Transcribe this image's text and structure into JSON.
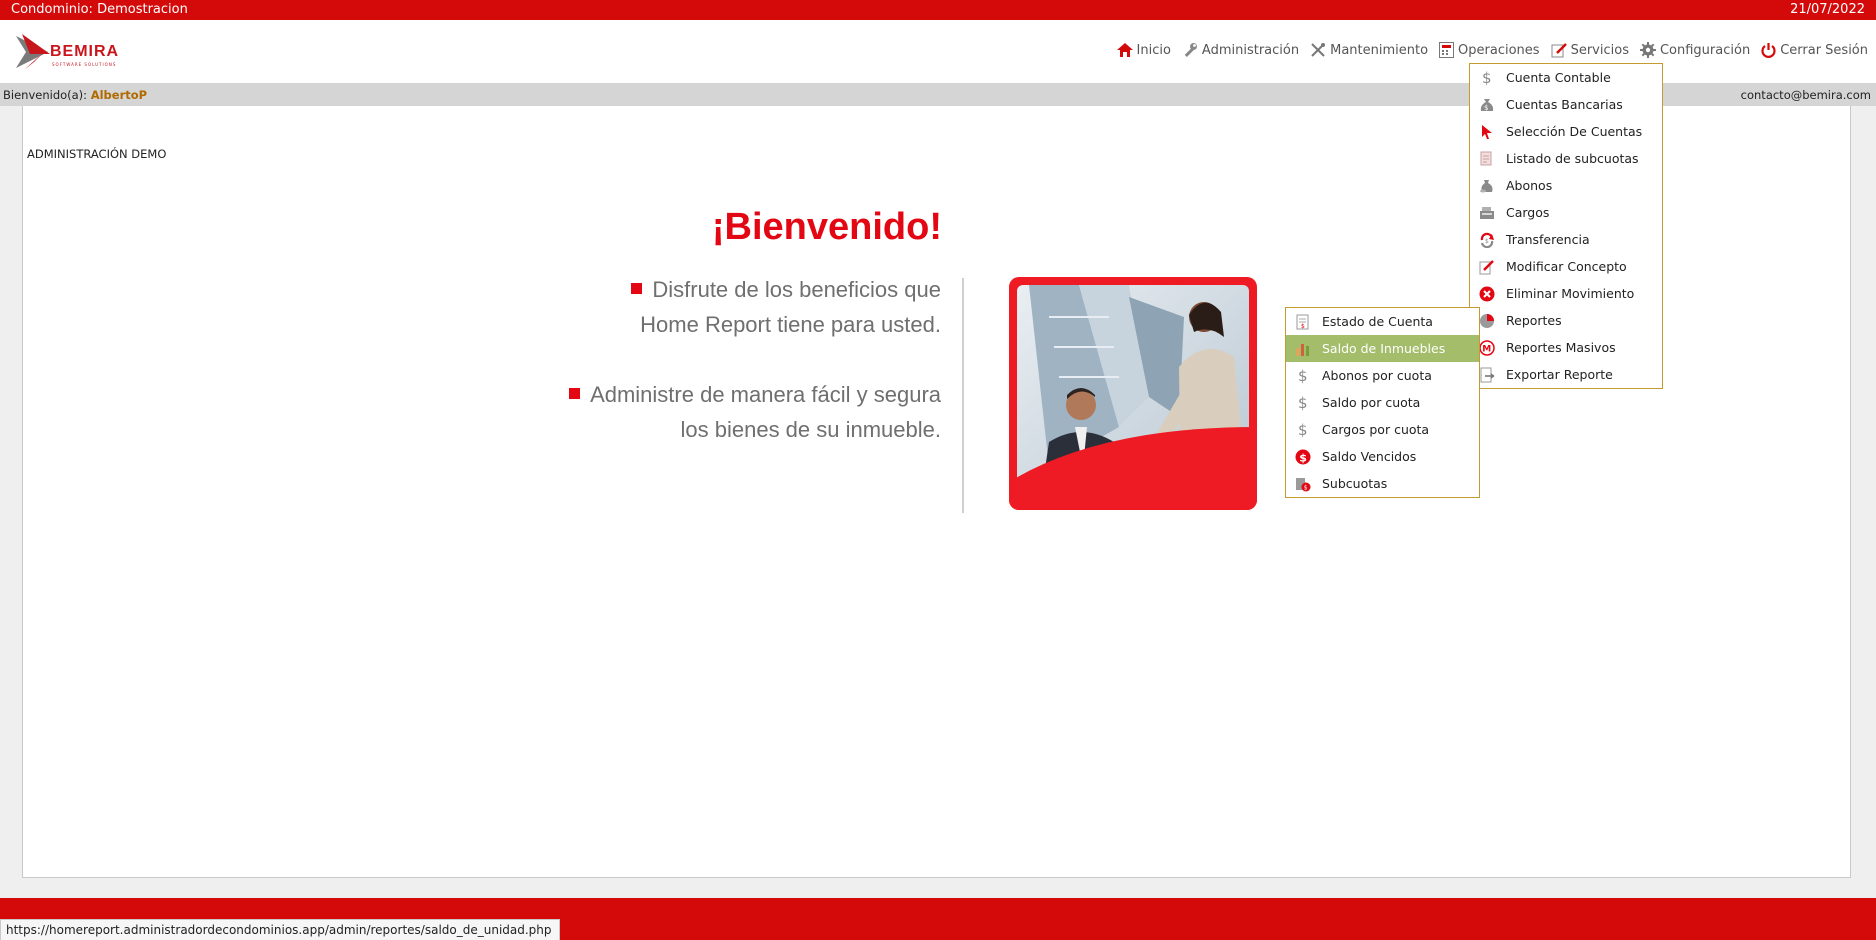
{
  "topbar": {
    "condo": "Condominio: Demostracion",
    "date": "21/07/2022"
  },
  "logo": {
    "brand": "BEMIRA",
    "tagline": "SOFTWARE SOLUTIONS"
  },
  "nav": [
    {
      "label": "Inicio",
      "icon": "home-icon"
    },
    {
      "label": "Administración",
      "icon": "wrench-icon"
    },
    {
      "label": "Mantenimiento",
      "icon": "tools-icon"
    },
    {
      "label": "Operaciones",
      "icon": "calculator-icon"
    },
    {
      "label": "Servicios",
      "icon": "edit-icon"
    },
    {
      "label": "Configuración",
      "icon": "gear-icon"
    },
    {
      "label": "Cerrar Sesión",
      "icon": "power-icon"
    }
  ],
  "welcomebar": {
    "prefix": "Bienvenido(a): ",
    "user": "AlbertoP",
    "email": "contacto@bemira.com"
  },
  "main": {
    "admin_title": "ADMINISTRACIÓN DEMO",
    "heading": "¡Bienvenido!",
    "benefit1_line1": "Disfrute de los beneficios que",
    "benefit1_line2": "Home Report tiene para usted.",
    "benefit2_line1": "Administre de manera fácil y segura",
    "benefit2_line2": "los bienes de su inmueble."
  },
  "operaciones_menu": [
    {
      "label": "Cuenta Contable",
      "icon": "dollar-icon"
    },
    {
      "label": "Cuentas Bancarias",
      "icon": "money-bag-icon"
    },
    {
      "label": "Selección De Cuentas",
      "icon": "cursor-icon"
    },
    {
      "label": "Listado de subcuotas",
      "icon": "list-icon"
    },
    {
      "label": "Abonos",
      "icon": "coin-bag-icon"
    },
    {
      "label": "Cargos",
      "icon": "cash-register-icon"
    },
    {
      "label": "Transferencia",
      "icon": "transfer-icon"
    },
    {
      "label": "Modificar Concepto",
      "icon": "edit-document-icon"
    },
    {
      "label": "Eliminar Movimiento",
      "icon": "delete-icon"
    },
    {
      "label": "Reportes",
      "icon": "pie-chart-icon"
    },
    {
      "label": "Reportes Masivos",
      "icon": "mass-report-icon"
    },
    {
      "label": "Exportar Reporte",
      "icon": "export-icon"
    }
  ],
  "reportes_menu": [
    {
      "label": "Estado de Cuenta",
      "icon": "statement-icon"
    },
    {
      "label": "Saldo de Inmuebles",
      "icon": "bar-chart-icon",
      "active": true
    },
    {
      "label": "Abonos por cuota",
      "icon": "dollar-icon"
    },
    {
      "label": "Saldo por cuota",
      "icon": "dollar-icon"
    },
    {
      "label": "Cargos por cuota",
      "icon": "dollar-icon"
    },
    {
      "label": "Saldo Vencidos",
      "icon": "dollar-circle-icon"
    },
    {
      "label": "Subcuotas",
      "icon": "subcuotas-icon"
    }
  ],
  "statusbar": {
    "url": "https://homereport.administradordecondominios.app/admin/reportes/saldo_de_unidad.php"
  },
  "colors": {
    "brand_red": "#d40a0a",
    "accent_red": "#e30613",
    "menu_border": "#c49b2e",
    "active_item": "#a3bd6a"
  }
}
